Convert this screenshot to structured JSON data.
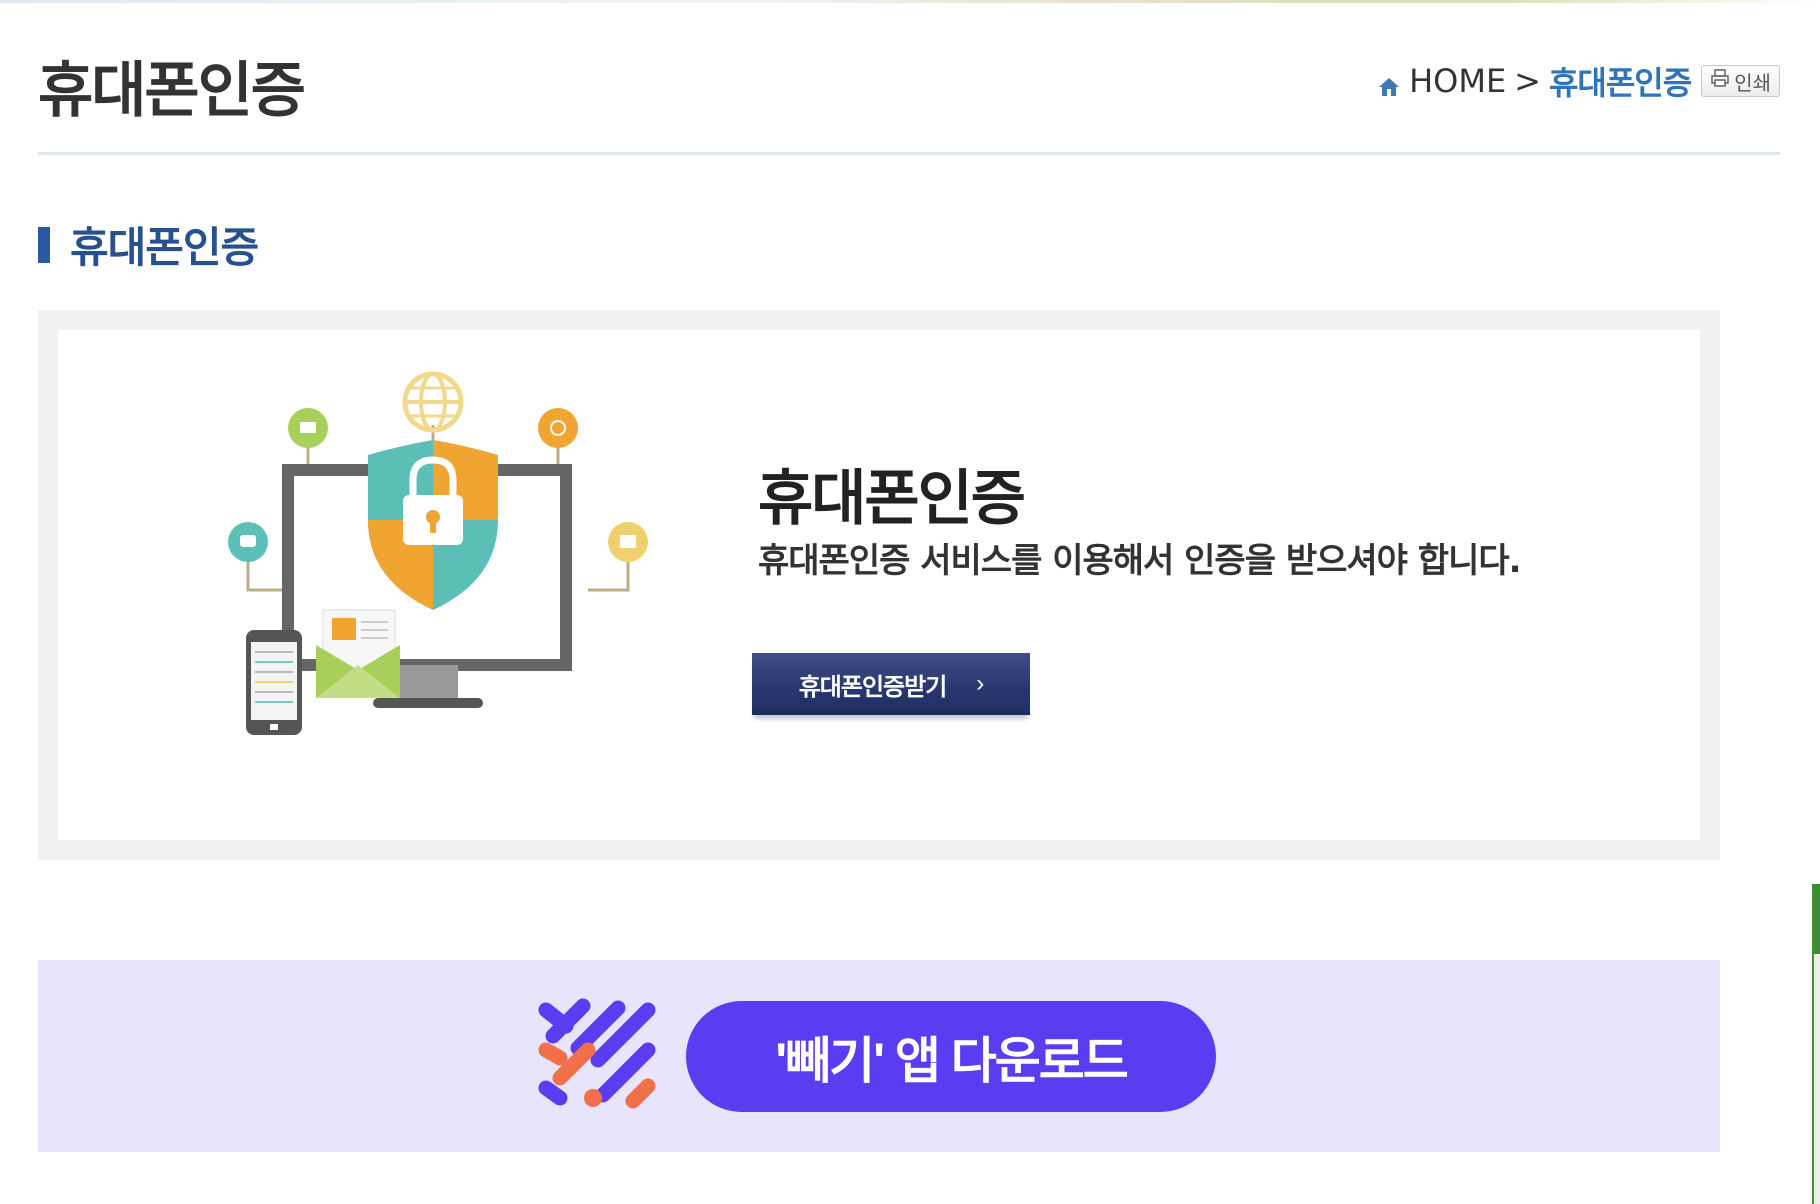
{
  "page": {
    "title": "휴대폰인증"
  },
  "breadcrumb": {
    "home_icon": "home-icon",
    "home_label": "HOME",
    "separator": ">",
    "current": "휴대폰인증",
    "print_icon": "printer-icon",
    "print_label": "인쇄"
  },
  "section": {
    "title": "휴대폰인증"
  },
  "panel": {
    "illustration_icon": "security-certification-illustration",
    "title": "휴대폰인증",
    "description": "휴대폰인증 서비스를 이용해서 인증을 받으셔야 합니다.",
    "button_label": "휴대폰인증받기",
    "button_arrow": "›"
  },
  "app_download": {
    "logo_icon": "baeggi-app-logo",
    "button_label": "'빼기' 앱 다운로드"
  },
  "colors": {
    "accent_blue": "#2f73b8",
    "section_blue": "#27508e",
    "button_navy": "#2a3a72",
    "app_purple": "#5b3cf0",
    "app_band": "#e8e4fb"
  }
}
